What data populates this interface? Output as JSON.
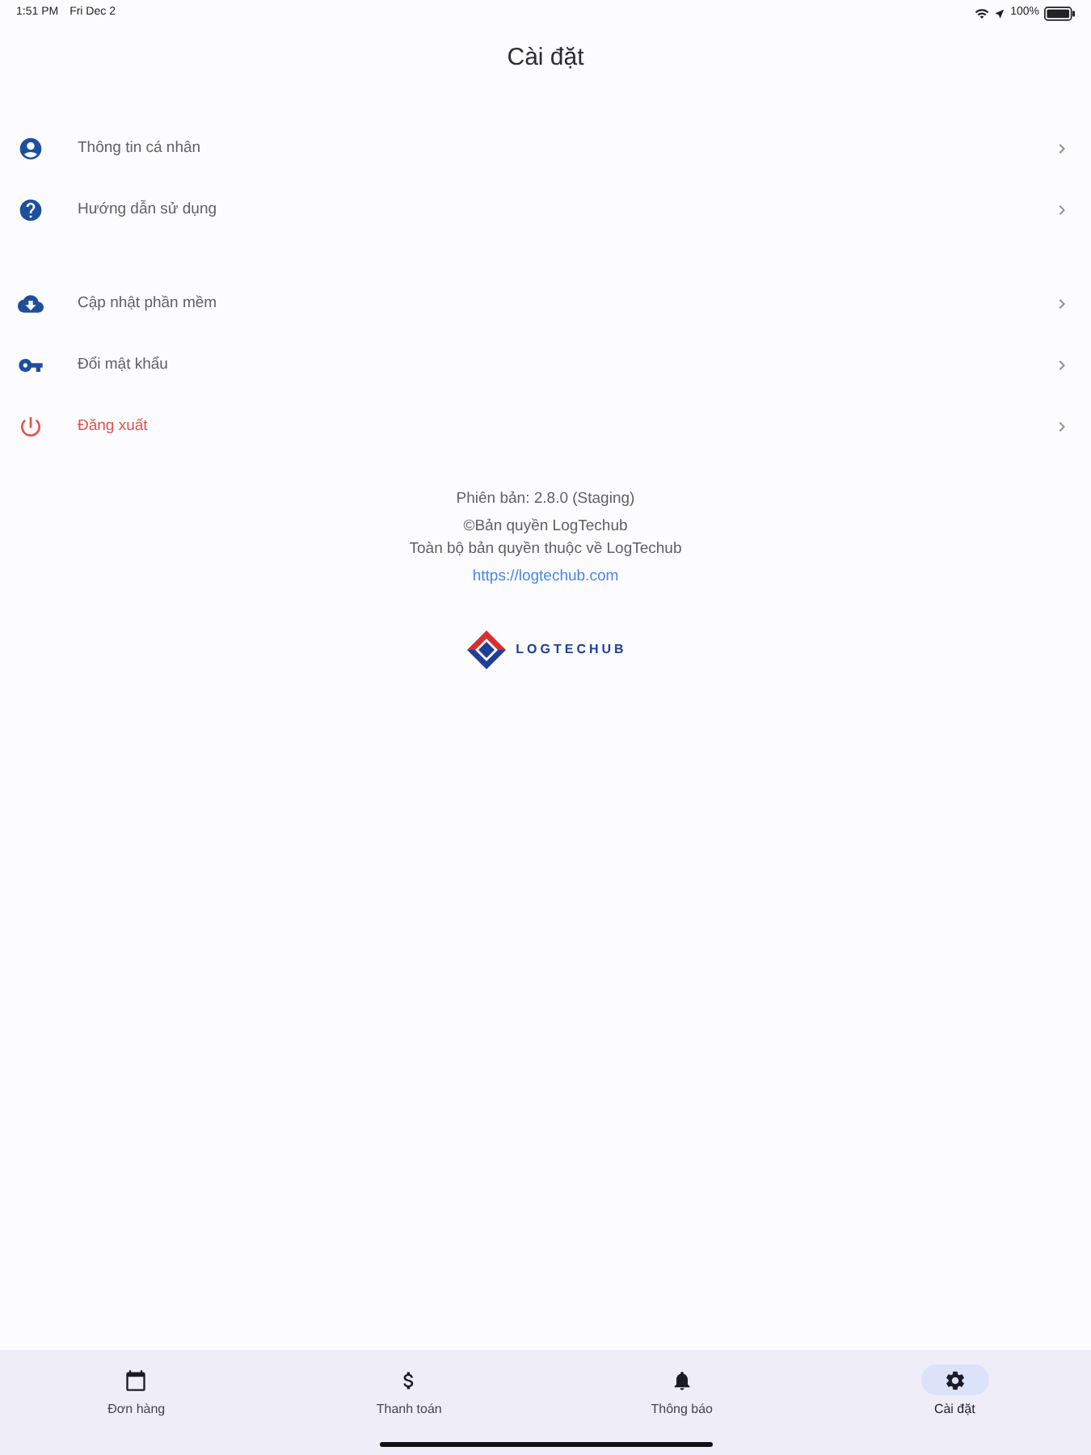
{
  "status_bar": {
    "time": "1:51 PM",
    "date": "Fri Dec 2",
    "battery": "100%"
  },
  "header": {
    "title": "Cài đặt"
  },
  "menu_sections": [
    {
      "items": [
        {
          "label": "Thông tin cá nhân",
          "kind": "normal"
        },
        {
          "label": "Hướng dẫn sử dụng",
          "kind": "normal"
        }
      ]
    },
    {
      "items": [
        {
          "label": "Cập nhật phần mềm",
          "kind": "normal"
        },
        {
          "label": "Đổi mật khẩu",
          "kind": "normal"
        },
        {
          "label": "Đăng xuất",
          "kind": "danger"
        }
      ]
    }
  ],
  "about": {
    "version": "Phiên bản: 2.8.0 (Staging)",
    "copyright": "©Bản quyền LogTechub",
    "rights": "Toàn bộ bản quyền thuộc về LogTechub",
    "link": "https://logtechub.com",
    "logo_text": "LOGTECHUB"
  },
  "bottom_nav": [
    {
      "label": "Đơn hàng",
      "selected": false
    },
    {
      "label": "Thanh toán",
      "selected": false
    },
    {
      "label": "Thông báo",
      "selected": false
    },
    {
      "label": "Cài đặt",
      "selected": true
    }
  ]
}
